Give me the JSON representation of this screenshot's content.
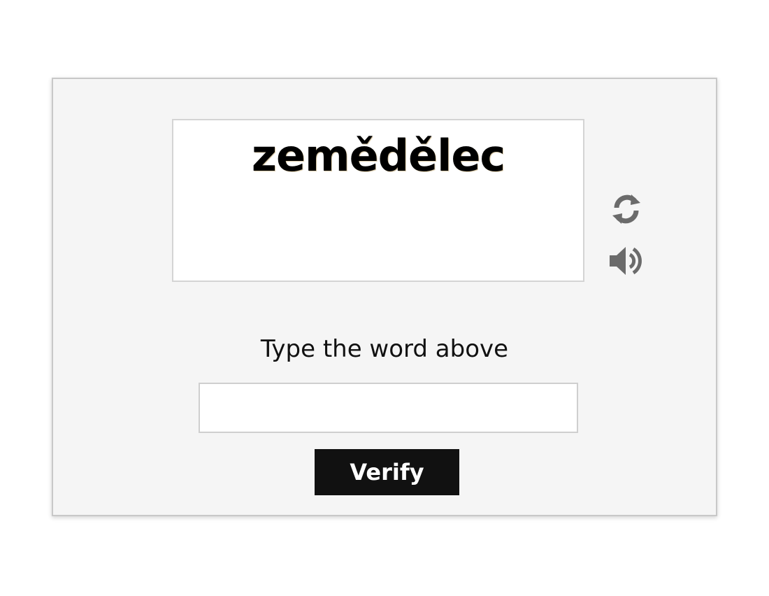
{
  "captcha": {
    "word": "zemědělec",
    "refresh_icon": "refresh-icon",
    "audio_icon": "speaker-icon"
  },
  "prompt": {
    "instruction": "Type the word above"
  },
  "form": {
    "answer_value": "",
    "answer_placeholder": "",
    "verify_label": "Verify"
  },
  "colors": {
    "card_background": "#f5f5f5",
    "icon_gray": "#6b6b6b",
    "button_background": "#111111",
    "button_text": "#ffffff"
  }
}
